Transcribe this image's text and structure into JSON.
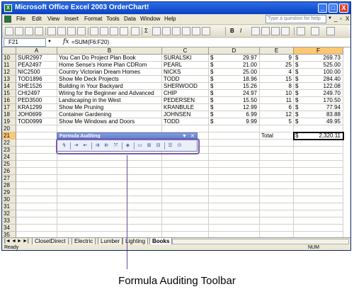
{
  "window": {
    "title": "Microsoft Office Excel 2003 OrderChart!",
    "app_icon": "excel-icon",
    "controls": [
      "_",
      "□",
      "X"
    ]
  },
  "menubar": {
    "items": [
      "File",
      "Edit",
      "View",
      "Insert",
      "Format",
      "Tools",
      "Data",
      "Window",
      "Help"
    ],
    "help_placeholder": "Type a question for help",
    "doc_controls": [
      "_",
      "▫",
      "X"
    ]
  },
  "toolbar": {
    "zoom_sigma": "Σ",
    "bold": "B",
    "italic": "I"
  },
  "formula_bar": {
    "name_box": "F21",
    "fx": "fx",
    "formula": "=SUM(F6:F20)"
  },
  "grid": {
    "columns": [
      "A",
      "B",
      "C",
      "D",
      "E",
      "F"
    ],
    "rows": [
      {
        "num": "10",
        "a": "SUR2997",
        "b": "You Can Do Project Plan Book",
        "c": "SURALSKI",
        "d_cur": "$",
        "d": "29.97",
        "e": "9",
        "f_cur": "$",
        "f": "269.73"
      },
      {
        "num": "11",
        "a": "PEA2497",
        "b": "Home Sense's Home Plan CDRom",
        "c": "PEARL",
        "d_cur": "$",
        "d": "21.00",
        "e": "25",
        "f_cur": "$",
        "f": "525.00"
      },
      {
        "num": "12",
        "a": "NIC2500",
        "b": "Country Victorian Dream Homes",
        "c": "NICKS",
        "d_cur": "$",
        "d": "25.00",
        "e": "4",
        "f_cur": "$",
        "f": "100.00"
      },
      {
        "num": "13",
        "a": "TOD1896",
        "b": "Show Me Deck Projects",
        "c": "TODD",
        "d_cur": "$",
        "d": "18.96",
        "e": "15",
        "f_cur": "$",
        "f": "284.40"
      },
      {
        "num": "14",
        "a": "SHE1526",
        "b": "Building in Your Backyard",
        "c": "SHERWOOD",
        "d_cur": "$",
        "d": "15.26",
        "e": "8",
        "f_cur": "$",
        "f": "122.08"
      },
      {
        "num": "15",
        "a": "CHI2497",
        "b": "Wiring for the Beginner and Advanced",
        "c": "CHIP",
        "d_cur": "$",
        "d": "24.97",
        "e": "10",
        "f_cur": "$",
        "f": "249.70"
      },
      {
        "num": "16",
        "a": "PED3500",
        "b": "Landscaping in the West",
        "c": "PEDERSEN",
        "d_cur": "$",
        "d": "15.50",
        "e": "11",
        "f_cur": "$",
        "f": "170.50"
      },
      {
        "num": "17",
        "a": "KRA1299",
        "b": "Show Me Pruning",
        "c": "KRANBULE",
        "d_cur": "$",
        "d": "12.99",
        "e": "6",
        "f_cur": "$",
        "f": "77.94"
      },
      {
        "num": "18",
        "a": "JOH0699",
        "b": "Container Gardening",
        "c": "JOHNSEN",
        "d_cur": "$",
        "d": "6.99",
        "e": "12",
        "f_cur": "$",
        "f": "83.88"
      },
      {
        "num": "19",
        "a": "TOD0999",
        "b": "Show Me Windows and Doors",
        "c": "TODD",
        "d_cur": "$",
        "d": "9.99",
        "e": "5",
        "f_cur": "$",
        "f": "49.95"
      },
      {
        "num": "20",
        "a": "",
        "b": "",
        "c": "",
        "d_cur": "",
        "d": "",
        "e": "",
        "f_cur": "",
        "f": ""
      },
      {
        "num": "21",
        "a": "",
        "b": "",
        "c": "",
        "d_cur": "",
        "d": "",
        "e": "Total",
        "f_cur": "$",
        "f": "2,320.11"
      },
      {
        "num": "22"
      },
      {
        "num": "23"
      },
      {
        "num": "24"
      },
      {
        "num": "25"
      },
      {
        "num": "26"
      },
      {
        "num": "27"
      },
      {
        "num": "28"
      },
      {
        "num": "29"
      },
      {
        "num": "30"
      },
      {
        "num": "31"
      },
      {
        "num": "32"
      },
      {
        "num": "33"
      },
      {
        "num": "34"
      },
      {
        "num": "35"
      }
    ]
  },
  "formula_auditing": {
    "title": "Formula Auditing",
    "buttons": [
      "error-check-icon",
      "trace-precedents-icon",
      "remove-precedent-arrows-icon",
      "trace-dependents-icon",
      "remove-dependent-arrows-icon",
      "remove-all-arrows-icon",
      "trace-error-icon",
      "new-comment-icon",
      "circle-invalid-data-icon",
      "clear-validation-circles-icon",
      "show-watch-window-icon",
      "evaluate-formula-icon"
    ]
  },
  "sheet_tabs": {
    "nav": [
      "|◄",
      "◄",
      "►",
      "►|"
    ],
    "tabs": [
      "ClosetDirect",
      "Electric",
      "Lumber",
      "Lighting",
      "Books"
    ],
    "active": "Books"
  },
  "status": {
    "text": "Ready",
    "num": "NUM"
  },
  "caption": "Formula Auditing Toolbar"
}
